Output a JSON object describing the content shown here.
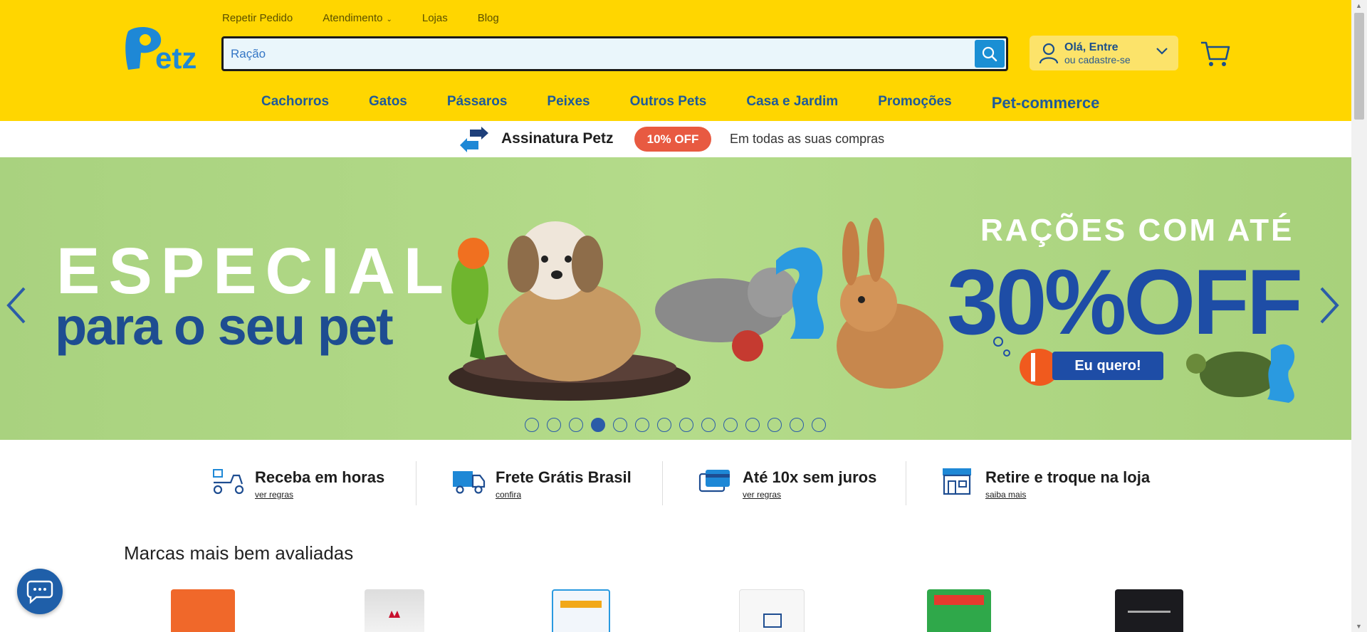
{
  "top_links": {
    "repeat_order": "Repetir Pedido",
    "support": "Atendimento",
    "stores": "Lojas",
    "blog": "Blog"
  },
  "search": {
    "value": "Ração",
    "placeholder": ""
  },
  "account": {
    "greeting": "Olá, Entre",
    "signup": "ou cadastre-se"
  },
  "nav": {
    "items": [
      "Cachorros",
      "Gatos",
      "Pássaros",
      "Peixes",
      "Outros Pets",
      "Casa e Jardim",
      "Promoções",
      "Pet-commerce"
    ]
  },
  "subscription_strip": {
    "title": "Assinatura Petz",
    "badge": "10% OFF",
    "subtitle": "Em todas as suas compras"
  },
  "banner": {
    "line1": "ESPECIAL",
    "line2": "para o seu pet",
    "promo_line1": "RAÇÕES COM ATÉ",
    "promo_line2": "30%OFF",
    "cta": "Eu quero!",
    "slide_count": 14,
    "active_slide": 4
  },
  "benefits": [
    {
      "title": "Receba em horas",
      "link": "ver regras"
    },
    {
      "title": "Frete Grátis Brasil",
      "link": "confira"
    },
    {
      "title": "Até 10x sem juros",
      "link": "ver regras"
    },
    {
      "title": "Retire e troque na loja",
      "link": "saiba mais"
    }
  ],
  "brands_section": {
    "title": "Marcas mais bem avaliadas"
  },
  "colors": {
    "header_bg": "#ffd600",
    "nav_text": "#1e5a9a",
    "search_button": "#1a8fd4",
    "badge": "#e85a41",
    "banner_bg": "#b4db8a",
    "banner_blue": "#1e4da6"
  }
}
